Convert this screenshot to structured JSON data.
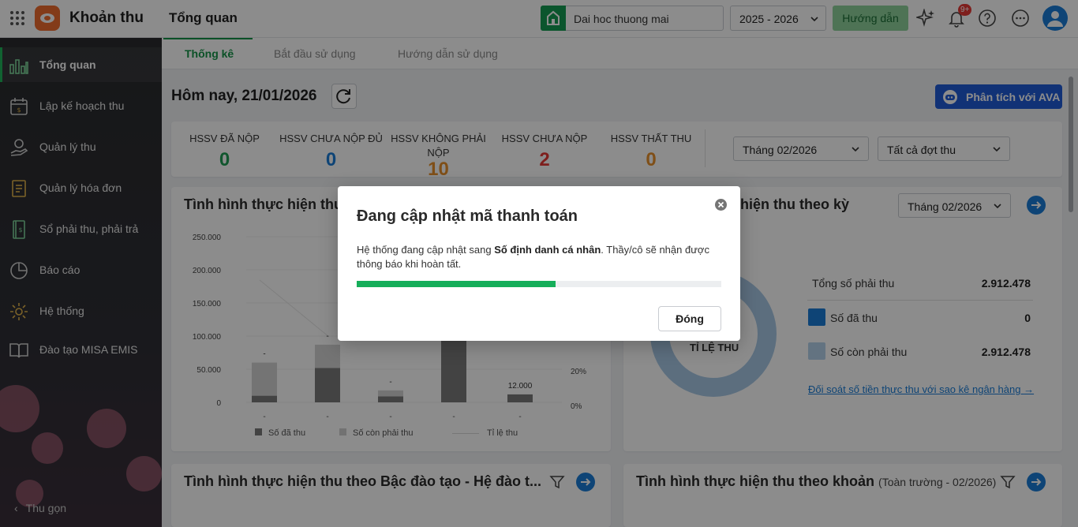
{
  "header": {
    "app_title": "Khoản thu",
    "page_title": "Tổng quan",
    "school": "Dai hoc thuong mai",
    "school_year": "2025 - 2026",
    "guide_label": "Hướng dẫn",
    "notification_badge": "9+"
  },
  "sidebar": {
    "items": [
      {
        "label": "Tổng quan",
        "icon": "bar-chart-icon",
        "active": true
      },
      {
        "label": "Lập kế hoạch thu",
        "icon": "calendar-money-icon"
      },
      {
        "label": "Quản lý thu",
        "icon": "hand-money-icon"
      },
      {
        "label": "Quản lý hóa đơn",
        "icon": "invoice-icon"
      },
      {
        "label": "Sổ phải thu, phải trả",
        "icon": "ledger-icon"
      },
      {
        "label": "Báo cáo",
        "icon": "pie-chart-icon"
      },
      {
        "label": "Hệ thống",
        "icon": "gear-icon"
      },
      {
        "label": "Đào tạo MISA EMIS",
        "icon": "book-icon"
      }
    ],
    "collapse_label": "Thu gọn"
  },
  "tabs": [
    "Thống kê",
    "Bắt đầu sử dụng",
    "Hướng dẫn sử dụng"
  ],
  "main": {
    "today_label": "Hôm nay, 21/01/2026",
    "ava_button": "Phân tích với AVA",
    "stats": [
      {
        "label": "HSSV ĐÃ NỘP",
        "value": "0",
        "color": "#1f9d55"
      },
      {
        "label": "HSSV CHƯA NỘP ĐỦ",
        "value": "0",
        "color": "#1a7dd7"
      },
      {
        "label": "HSSV KHÔNG PHẢI NỘP",
        "value": "10",
        "color": "#e8912d"
      },
      {
        "label": "HSSV CHƯA NỘP",
        "value": "2",
        "color": "#e53935"
      },
      {
        "label": "HSSV THẤT THU",
        "value": "0",
        "color": "#e8912d"
      }
    ],
    "month_filter": "Tháng 02/2026",
    "period_filter": "Tất cả đợt thu",
    "card1_title": "Tình hình thực hiện thu",
    "card2_title": "hiện thu theo kỳ",
    "card2_filter": "Tháng 02/2026",
    "ratio": {
      "center_label": "TỈ LỆ THU",
      "total_label": "Tổng số phải thu",
      "total_value": "2.912.478",
      "collected_label": "Số đã thu",
      "collected_value": "0",
      "remaining_label": "Số còn phải thu",
      "remaining_value": "2.912.478",
      "reconcile_link": "Đối soát số tiền thực thu với sao kê ngân hàng"
    },
    "card3_title": "Tình hình thực hiện thu theo Bậc đào tạo - Hệ đào t...",
    "card4_title": "Tình hình thực hiện thu theo khoản",
    "card4_sub": "(Toàn trường - 02/2026)"
  },
  "chart_data": {
    "type": "bar",
    "y_ticks": [
      "250.000",
      "200.000",
      "150.000",
      "100.000",
      "50.000",
      "0"
    ],
    "y2_ticks": [
      "40%",
      "20%",
      "0%"
    ],
    "ylim": [
      0,
      250000
    ],
    "categories": [
      "-",
      "-",
      "-",
      "-",
      "-"
    ],
    "data_labels": [
      "-",
      "-",
      "-",
      "-",
      "12.000"
    ],
    "series": [
      {
        "name": "Số đã thu",
        "values": [
          10000,
          52000,
          9000,
          102000,
          12000
        ]
      },
      {
        "name": "Số còn phải thu",
        "values": [
          50000,
          35000,
          9000,
          0,
          0
        ]
      },
      {
        "name": "Tỉ lệ thu",
        "values": []
      }
    ],
    "legend": [
      "Số đã thu",
      "Số còn phải thu",
      "Tỉ lệ thu"
    ]
  },
  "modal": {
    "title": "Đang cập nhật mã thanh toán",
    "body_prefix": "Hệ thống đang cập nhật sang ",
    "body_bold": "Số định danh cá nhân",
    "body_suffix": ". Thầy/cô sẽ nhận được thông báo khi hoàn tất.",
    "progress": 0.545,
    "close_button": "Đóng"
  }
}
